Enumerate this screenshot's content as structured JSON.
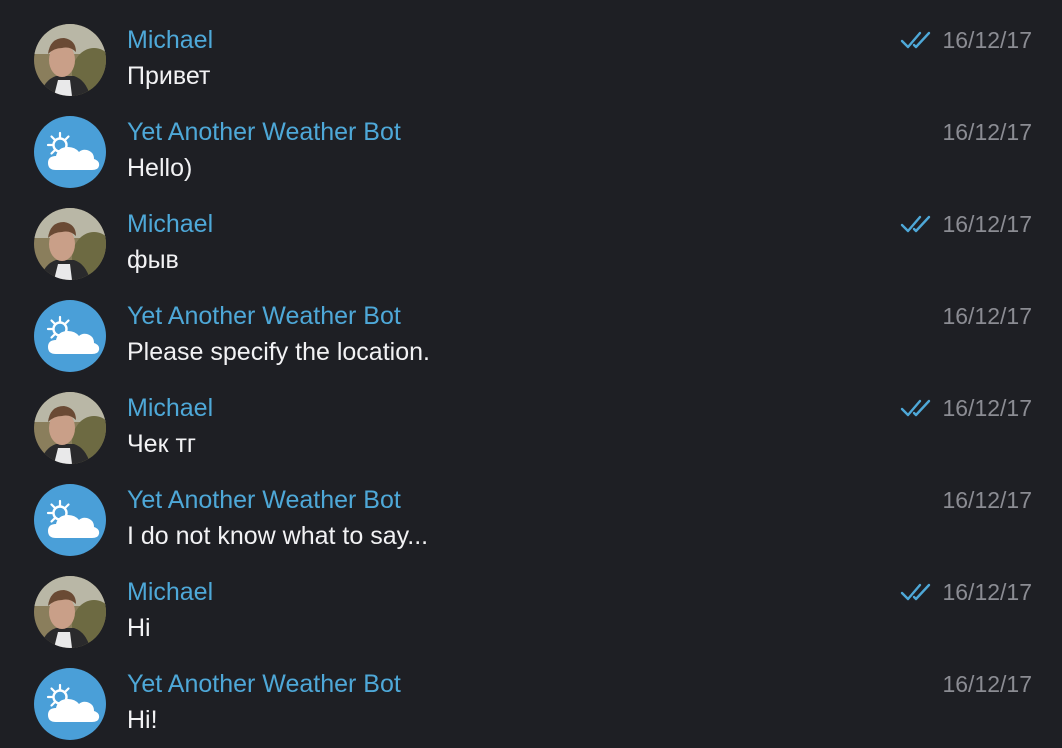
{
  "colors": {
    "background": "#1e1f24",
    "sender_name": "#4ea8d8",
    "message_text": "#f2f2f4",
    "timestamp": "#8b8c93",
    "read_check": "#4ea8d8",
    "bot_avatar": "#4a9fd8"
  },
  "messages": [
    {
      "sender": "Michael",
      "text": "Привет",
      "date": "16/12/17",
      "avatar": "user-photo-avatar",
      "read_icon": "double-check-icon"
    },
    {
      "sender": "Yet Another Weather Bot",
      "text": "Hello)",
      "date": "16/12/17",
      "avatar": "weather-bot-avatar"
    },
    {
      "sender": "Michael",
      "text": "фыв",
      "date": "16/12/17",
      "avatar": "user-photo-avatar",
      "read_icon": "double-check-icon"
    },
    {
      "sender": "Yet Another Weather Bot",
      "text": "Please specify the location.",
      "date": "16/12/17",
      "avatar": "weather-bot-avatar"
    },
    {
      "sender": "Michael",
      "text": "Чек тг",
      "date": "16/12/17",
      "avatar": "user-photo-avatar",
      "read_icon": "double-check-icon"
    },
    {
      "sender": "Yet Another Weather Bot",
      "text": "I do not know what to say...",
      "date": "16/12/17",
      "avatar": "weather-bot-avatar"
    },
    {
      "sender": "Michael",
      "text": "Hi",
      "date": "16/12/17",
      "avatar": "user-photo-avatar",
      "read_icon": "double-check-icon"
    },
    {
      "sender": "Yet Another Weather Bot",
      "text": "Hi!",
      "date": "16/12/17",
      "avatar": "weather-bot-avatar"
    }
  ]
}
